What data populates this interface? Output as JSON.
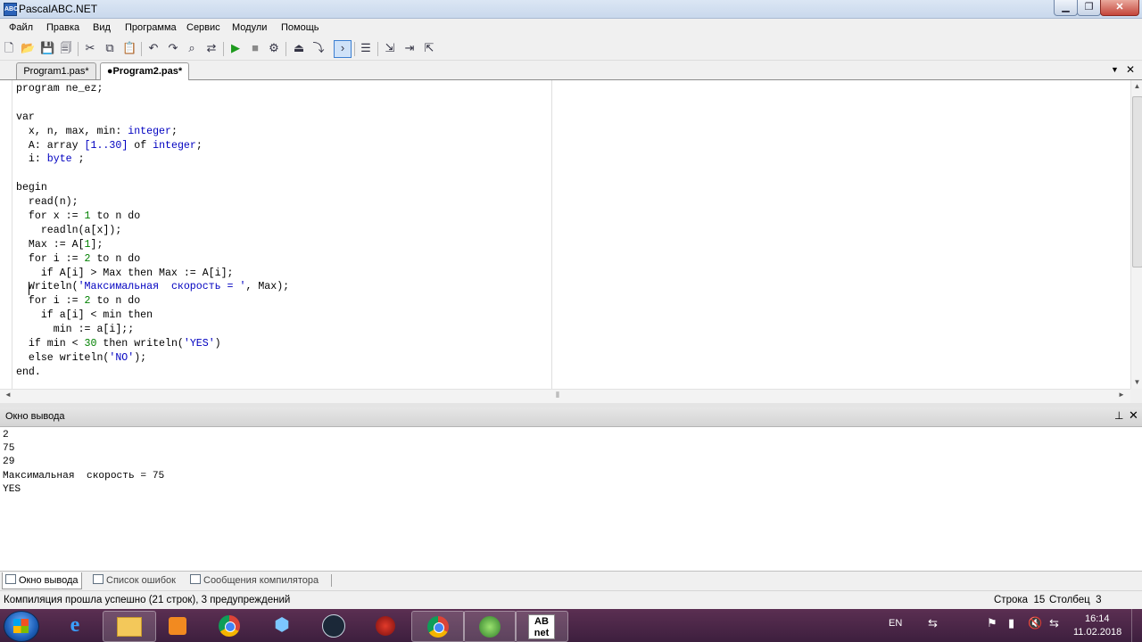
{
  "window": {
    "title": "PascalABC.NET",
    "icon": "abc-icon",
    "minimize": "▁",
    "maximize": "❐",
    "close": "✕"
  },
  "menu": [
    "Файл",
    "Правка",
    "Вид",
    "Программа",
    "Сервис",
    "Модули",
    "Помощь"
  ],
  "toolbar": {
    "new": "🗋",
    "open": "📂",
    "save": "💾",
    "save_all": "🗐",
    "cut": "✂",
    "copy": "⧉",
    "paste": "📋",
    "undo": "↶",
    "redo": "↷",
    "find": "⌕",
    "replace": "⇄",
    "run": "▶",
    "stop": "■",
    "compile": "⚙",
    "debug": "⏏",
    "step": "⤵",
    "console": "›",
    "format": "☰",
    "step_into": "⇲",
    "step_over": "⇥",
    "step_out": "⇱"
  },
  "tabs": [
    {
      "label": "Program1.pas*",
      "active": false
    },
    {
      "label": "●Program2.pas*",
      "active": true
    }
  ],
  "tab_dropdown": "▼",
  "tab_close": "✕",
  "editor": {
    "lines": [
      "program ne_ez;",
      "",
      "var",
      "  x, n, max, min: integer;",
      "  A: array [1..30] of integer;",
      "  i: byte ;",
      "",
      "begin",
      "  read(n);",
      "  for x := 1 to n do",
      "    readln(a[x]);",
      "  Max := A[1];",
      "  for i := 2 to n do",
      "    if A[i] > Max then Max := A[i];",
      "  Writeln('Максимальная  скорость = ', Max);",
      "  for i := 2 to n do",
      "    if a[i] < min then",
      "      min := a[i];;",
      "  if min < 30 then writeln('YES')",
      "  else writeln('NO');",
      "end."
    ]
  },
  "output": {
    "title": "Окно вывода",
    "pin": "⊥",
    "close": "✕",
    "lines": [
      "2",
      "75",
      "29",
      "Максимальная  скорость = 75",
      "YES"
    ]
  },
  "bottom_tabs": [
    "Окно вывода",
    "Список ошибок",
    "Сообщения компилятора"
  ],
  "status": {
    "message": "Компиляция прошла успешно (21 строк), 3 предупреждений",
    "line_label": "Строка",
    "line": "15",
    "col_label": "Столбец",
    "col": "3"
  },
  "taskbar": {
    "lang": "EN",
    "time": "16:14",
    "date": "11.02.2018",
    "pascal_icon_text": "AB net",
    "ie": "e",
    "vs": "⬢",
    "tray_icons": {
      "network": "⚑",
      "flag": "▮",
      "sound": "🔇",
      "arrow": "⇆"
    }
  },
  "scrollbars": {
    "up": "▲",
    "down": "▼",
    "left": "◄",
    "right": "►",
    "grip": "⦀"
  },
  "colors": {
    "type": "#0000c0",
    "number": "#008000",
    "string": "#0000c0",
    "taskbar": "#4a2546"
  }
}
